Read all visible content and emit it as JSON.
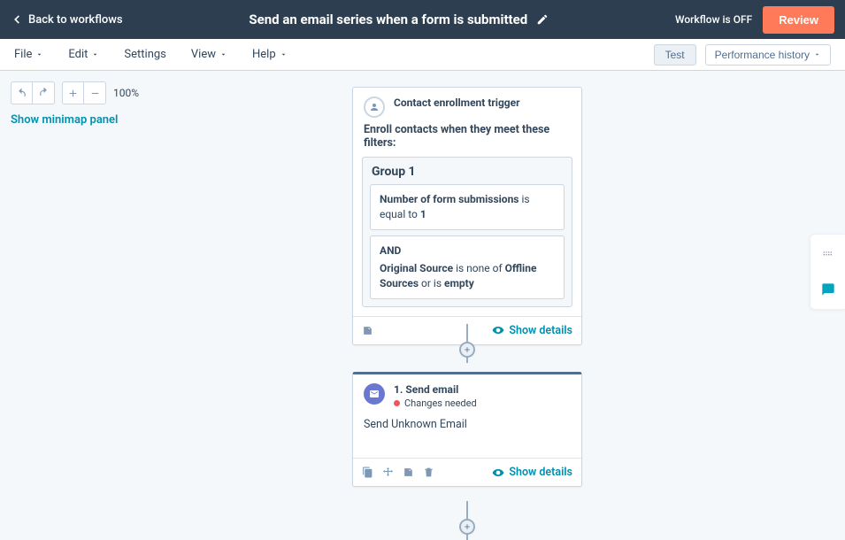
{
  "topbar": {
    "back_label": "Back to workflows",
    "title": "Send an email series when a form is submitted",
    "workflow_state": "Workflow is OFF",
    "review_label": "Review"
  },
  "menubar": {
    "file": "File",
    "edit": "Edit",
    "settings": "Settings",
    "view": "View",
    "help": "Help",
    "test": "Test",
    "performance_history": "Performance history"
  },
  "tools": {
    "zoom_level": "100%",
    "minimap_label": "Show minimap panel"
  },
  "trigger": {
    "title": "Contact enrollment trigger",
    "description": "Enroll contacts when they meet these filters:",
    "group_label": "Group 1",
    "filter1_prop": "Number of form submissions",
    "filter1_op": "is equal to",
    "filter1_val": "1",
    "and_label": "AND",
    "filter2_prop": "Original Source",
    "filter2_op_a": "is none of",
    "filter2_val_a": "Offline Sources",
    "filter2_op_b": "or is",
    "filter2_val_b": "empty",
    "show_details": "Show details"
  },
  "action": {
    "title": "1. Send email",
    "status": "Changes needed",
    "body": "Send Unknown Email",
    "show_details": "Show details"
  }
}
